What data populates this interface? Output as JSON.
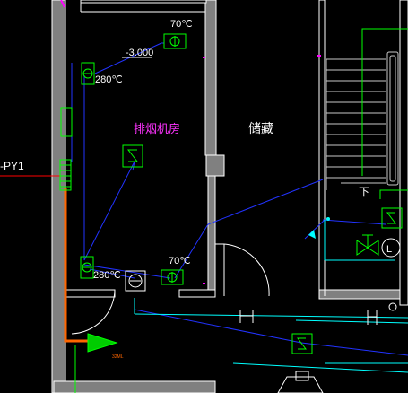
{
  "labels": {
    "room_fan": "排烟机房",
    "room_storage": "储藏",
    "elevation": "-3.000",
    "temp_70_top": "70℃",
    "temp_70_bottom": "70℃",
    "temp_280_top": "280℃",
    "temp_280_bottom": "280℃",
    "duct_code": "-PY1",
    "stair_down": "下",
    "small_tag": "32ML"
  },
  "colors": {
    "background": "#000000",
    "wall_fill": "#808080",
    "wall_edge": "#ffffff",
    "duct_blue": "#2233ff",
    "pipe_cyan": "#00ffff",
    "device_green": "#00ff00",
    "stair_gray": "#c8c8c8",
    "room_label": "#ff33ff",
    "text_white": "#ffffff",
    "duct_orange": "#ff6600",
    "leader_red": "#ff0000",
    "door_white": "#ffffff",
    "magenta_tick": "#ff00ff"
  },
  "symbols": {
    "fire_damper": "fire-damper-icon",
    "fan": "fan-icon",
    "switch": "s-switch-icon",
    "valve": "valve-icon",
    "pump": "pump-icon"
  }
}
